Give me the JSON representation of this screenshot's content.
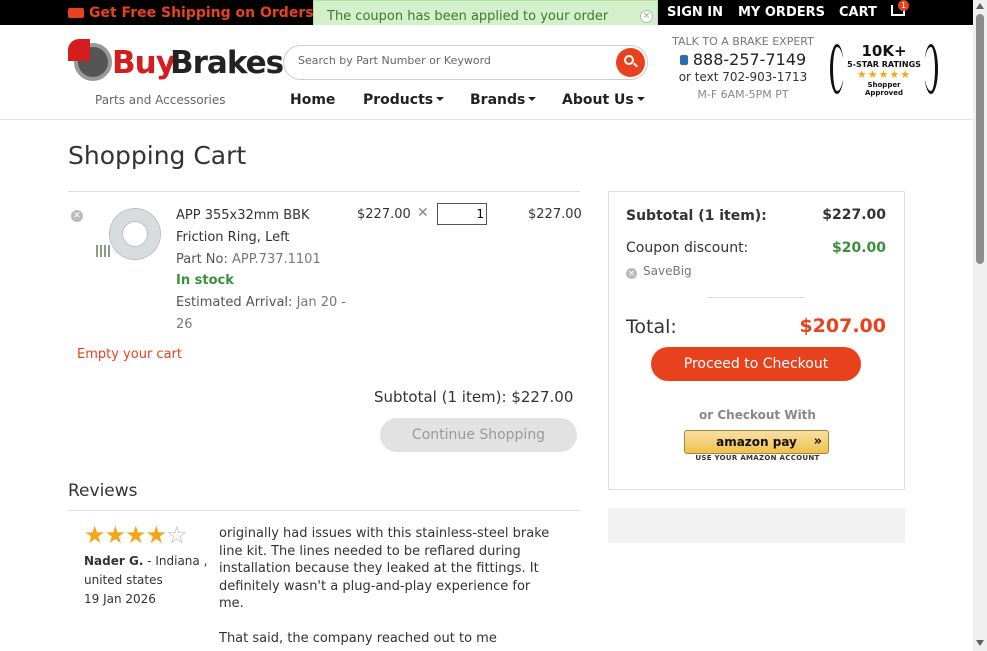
{
  "topbar": {
    "shipping_text": "Get Free Shipping on Orders Over",
    "sign_in": "SIGN IN",
    "my_orders": "MY ORDERS",
    "cart": "CART",
    "cart_count": "1"
  },
  "toast": {
    "message": "The coupon has been applied to your order",
    "close": "×"
  },
  "header": {
    "logo_buy": "Buy",
    "logo_brakes": "Brakes",
    "tagline": "Parts and Accessories",
    "search_placeholder": "Search by Part Number or Keyword",
    "nav": [
      "Home",
      "Products",
      "Brands",
      "About Us"
    ],
    "expert_title": "TALK TO A BRAKE EXPERT",
    "phone": "888-257-7149",
    "text_line": "or text 702-903-1713",
    "hours": "M-F 6AM-5PM PT",
    "badge_big": "10K+",
    "badge_sub": "5-STAR RATINGS",
    "badge_stars": "★★★★★",
    "badge_shopper": "Shopper",
    "badge_approved": "Approved"
  },
  "cart": {
    "title": "Shopping Cart",
    "item": {
      "name": "APP 355x32mm BBK Friction Ring, Left",
      "part_label": "Part No:",
      "part_no": "APP.737.1101",
      "stock": "In stock",
      "arrival_label": "Estimated Arrival:",
      "arrival": "Jan 20 - 26",
      "price": "$227.00",
      "times": "✕",
      "quantity": "1",
      "total": "$227.00"
    },
    "empty_cart": "Empty your cart",
    "subtotal_line": "Subtotal (1 item): $227.00",
    "continue": "Continue Shopping"
  },
  "summary": {
    "subtotal_label": "Subtotal (1 item):",
    "subtotal_value": "$227.00",
    "coupon_label": "Coupon discount:",
    "coupon_value": "$20.00",
    "coupon_code": "SaveBig",
    "total_label": "Total:",
    "total_value": "$207.00",
    "checkout": "Proceed to Checkout",
    "or_checkout": "or Checkout With",
    "amazon_label": "amazon pay",
    "amazon_chevron": "»",
    "amazon_sub": "USE YOUR AMAZON ACCOUNT"
  },
  "reviews": {
    "heading": "Reviews",
    "items": [
      {
        "stars_filled": "★★★★",
        "stars_empty": "☆",
        "rating": 4,
        "name": "Nader G.",
        "location_state": "- Indiana ,",
        "location_country": "united states",
        "date": "19 Jan 2026",
        "paragraph1": "originally had issues with this stainless-steel brake line kit. The lines needed to be reflared during installation because they leaked at the fittings. It definitely wasn't a plug-and-play experience for me.",
        "paragraph2": "That said, the company reached out to me"
      }
    ]
  },
  "colors": {
    "accent": "#e8411e",
    "success": "#3a8f3a",
    "toast_bg": "#d4f0cb"
  }
}
